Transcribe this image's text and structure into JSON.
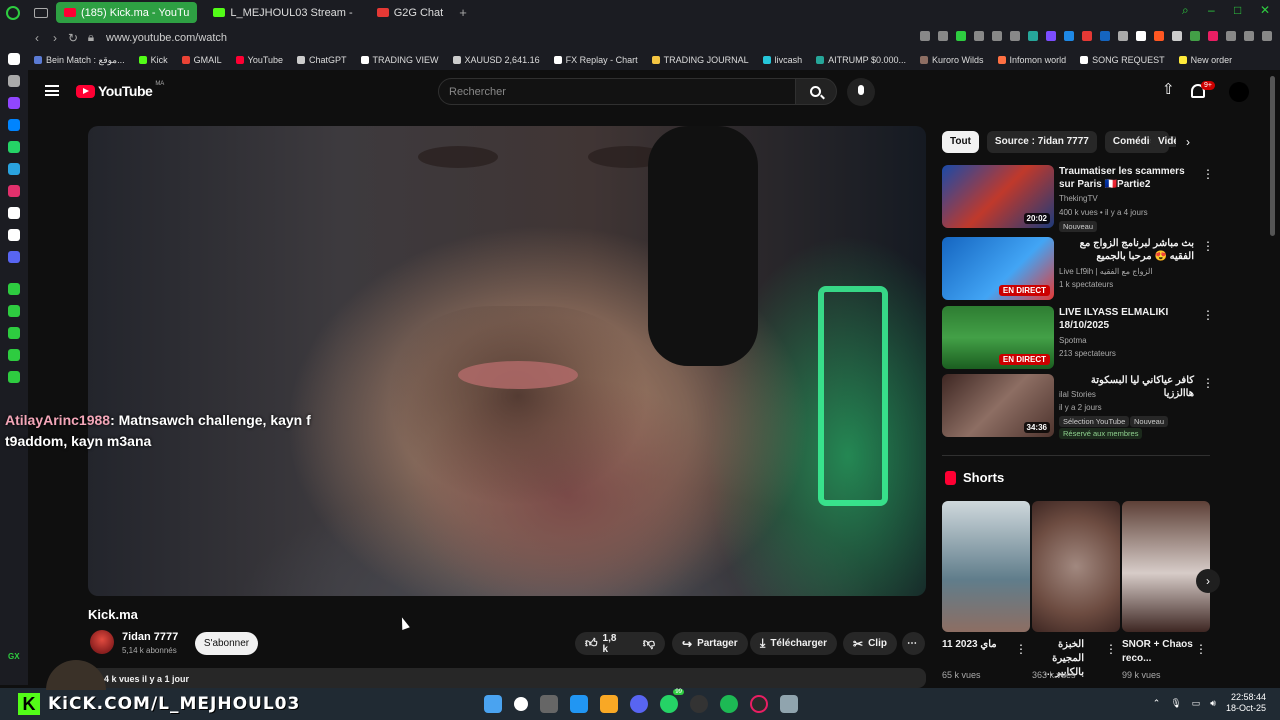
{
  "browser": {
    "tabs": [
      {
        "label": "(185) Kick.ma - YouTu",
        "active": true,
        "color": "#ff0033"
      },
      {
        "label": "L_MEJHOUL03 Stream - ",
        "active": false,
        "color": "#53fc18"
      },
      {
        "label": "G2G Chat",
        "active": false,
        "color": "#e53935"
      }
    ],
    "url": "www.youtube.com/watch",
    "bookmarks": [
      {
        "label": "Bein Match : موقع...",
        "color": "#5b7bd5"
      },
      {
        "label": "Kick",
        "color": "#53fc18"
      },
      {
        "label": "GMAIL",
        "color": "#ea4335"
      },
      {
        "label": "YouTube",
        "color": "#ff0033"
      },
      {
        "label": "ChatGPT",
        "color": "#cccccc"
      },
      {
        "label": "TRADING VIEW",
        "color": "#ffffff"
      },
      {
        "label": "XAUUSD 2,641.16",
        "color": "#cccccc"
      },
      {
        "label": "FX Replay - Chart",
        "color": "#ffffff"
      },
      {
        "label": "TRADING JOURNAL",
        "color": "#f4c542"
      },
      {
        "label": "livcash",
        "color": "#26c6da"
      },
      {
        "label": "AITRUMP $0.000...",
        "color": "#26a69a"
      },
      {
        "label": "Kuroro Wilds",
        "color": "#8d6e63"
      },
      {
        "label": "Infomon world",
        "color": "#ff7043"
      },
      {
        "label": "SONG REQUEST",
        "color": "#ffffff"
      },
      {
        "label": "New order",
        "color": "#ffeb3b"
      }
    ]
  },
  "header": {
    "logo_text": "YouTube",
    "country": "MA",
    "search_placeholder": "Rechercher",
    "notifications": "9+"
  },
  "video": {
    "chat_user": "AtilayArinc1988",
    "chat_message": ": Matnsawch challenge, kayn f t9addom, kayn m3ana",
    "title": "Kick.ma",
    "channel": "7idan 7777",
    "subscribers": "5,14 k abonnés",
    "subscribe_label": "S'abonner",
    "likes": "1,8 k",
    "share_label": "Partager",
    "download_label": "Télécharger",
    "clip_label": "Clip",
    "more_label": "⋯",
    "views_line": "4 k vues  il y a 1 jour"
  },
  "chips": [
    "Tout",
    "Source : 7idan 7777",
    "Comédies",
    "Vidéos"
  ],
  "recommendations": [
    {
      "title": "Traumatiser les scammers sur Paris 🇫🇷Partie2",
      "channel": "ThekingTV",
      "meta": "400 k vues • il y a 4 jours",
      "badge": "Nouveau",
      "duration": "20:02"
    },
    {
      "title": "بث مباشر لبرنامج الزواج مع الفقيه 😍 مرحبا بالجميع",
      "channel": "Live Lf9ih | الزواج مع الفقيه",
      "meta": "1 k spectateurs",
      "live": "EN DIRECT"
    },
    {
      "title": "LIVE ILYASS ELMALIKI 18/10/2025",
      "channel": "Spotma",
      "meta": "213 spectateurs",
      "live": "EN DIRECT"
    },
    {
      "title": "كافر عياكاني ليا البسكوتة هاالززيا",
      "channel": "ilal Stories",
      "meta": "il y a 2 jours",
      "badge": "Sélection YouTube",
      "badge2": "Nouveau",
      "members": "Réservé aux membres",
      "duration": "34:36"
    }
  ],
  "shorts": {
    "heading": "Shorts",
    "items": [
      {
        "title": "11 2023 ماي",
        "views": "65 k vues"
      },
      {
        "title": "الخبزة المجيرة بالكابير ...",
        "views": "363 k vues"
      },
      {
        "title": "SNOR + Chaos reco...",
        "views": "99 k vues"
      }
    ]
  },
  "overlay": {
    "kick_letter": "K",
    "kick_url": "KiCK.COM/L_MEJHOUL03"
  },
  "taskbar": {
    "time": "22:58:44",
    "date": "18-Oct-25",
    "discord_badge": "99"
  },
  "sidebar_label": "GX"
}
